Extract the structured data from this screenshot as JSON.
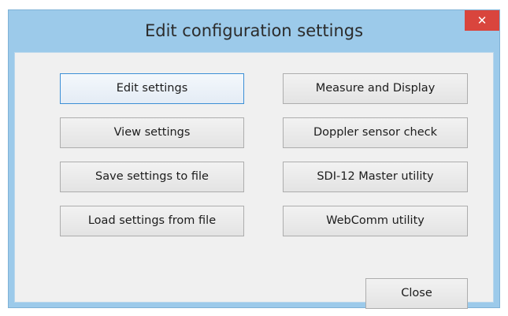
{
  "window": {
    "title": "Edit configuration settings",
    "close_glyph": "✕"
  },
  "buttons": {
    "edit_settings": "Edit settings",
    "view_settings": "View settings",
    "save_settings": "Save settings to file",
    "load_settings": "Load settings from file",
    "measure_display": "Measure and Display",
    "doppler_check": "Doppler sensor check",
    "sdi12_master": "SDI-12 Master utility",
    "webcomm": "WebComm utility",
    "close": "Close"
  },
  "colors": {
    "frame": "#9ccaea",
    "close_button": "#d9453d",
    "client_bg": "#f0f0f0",
    "focus_border": "#3c8fd6"
  },
  "icons": {
    "close": "close-icon"
  }
}
